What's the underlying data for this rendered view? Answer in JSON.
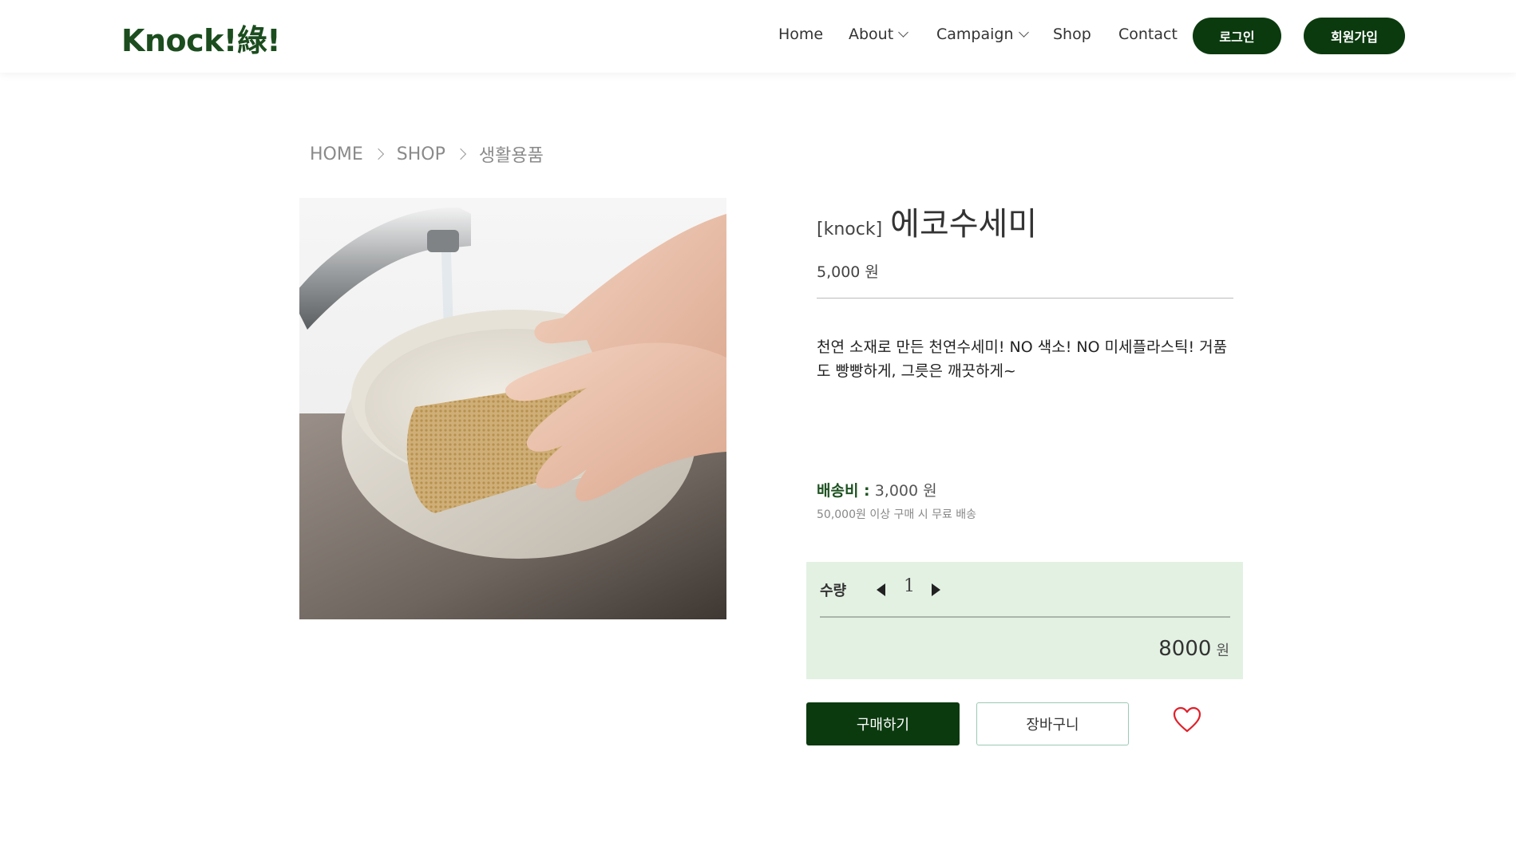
{
  "header": {
    "logo": "Knock!綠!",
    "nav": [
      {
        "label": "Home"
      },
      {
        "label": "About"
      },
      {
        "label": "Campaign"
      },
      {
        "label": "Shop"
      },
      {
        "label": "Contact"
      }
    ],
    "login_label": "로그인",
    "signup_label": "회원가입"
  },
  "breadcrumb": [
    "HOME",
    "SHOP",
    "생활용품"
  ],
  "product": {
    "brand": "[knock]",
    "name": "에코수세미",
    "price": "5,000 원",
    "description": "천연 소재로 만든 천연수세미! NO 색소! NO 미세플라스틱! 거품도 빵빵하게, 그릇은 깨끗하게~",
    "shipping_label": "배송비 :",
    "shipping_value": "3,000 원",
    "shipping_note": "50,000원 이상 구매 시 무료 배송"
  },
  "quantity": {
    "label": "수량",
    "value": "1",
    "total": "8000",
    "total_unit": "원"
  },
  "actions": {
    "buy_label": "구매하기",
    "cart_label": "장바구니"
  },
  "colors": {
    "brand_green": "#0b3a0e",
    "logo_green": "#1b4d1e",
    "qty_bg": "#e3f1e3",
    "heart": "#e0202a"
  },
  "icons": {
    "chevron": "chevron-down-icon",
    "heart": "heart-icon",
    "decrement": "triangle-left-icon",
    "increment": "triangle-right-icon"
  }
}
